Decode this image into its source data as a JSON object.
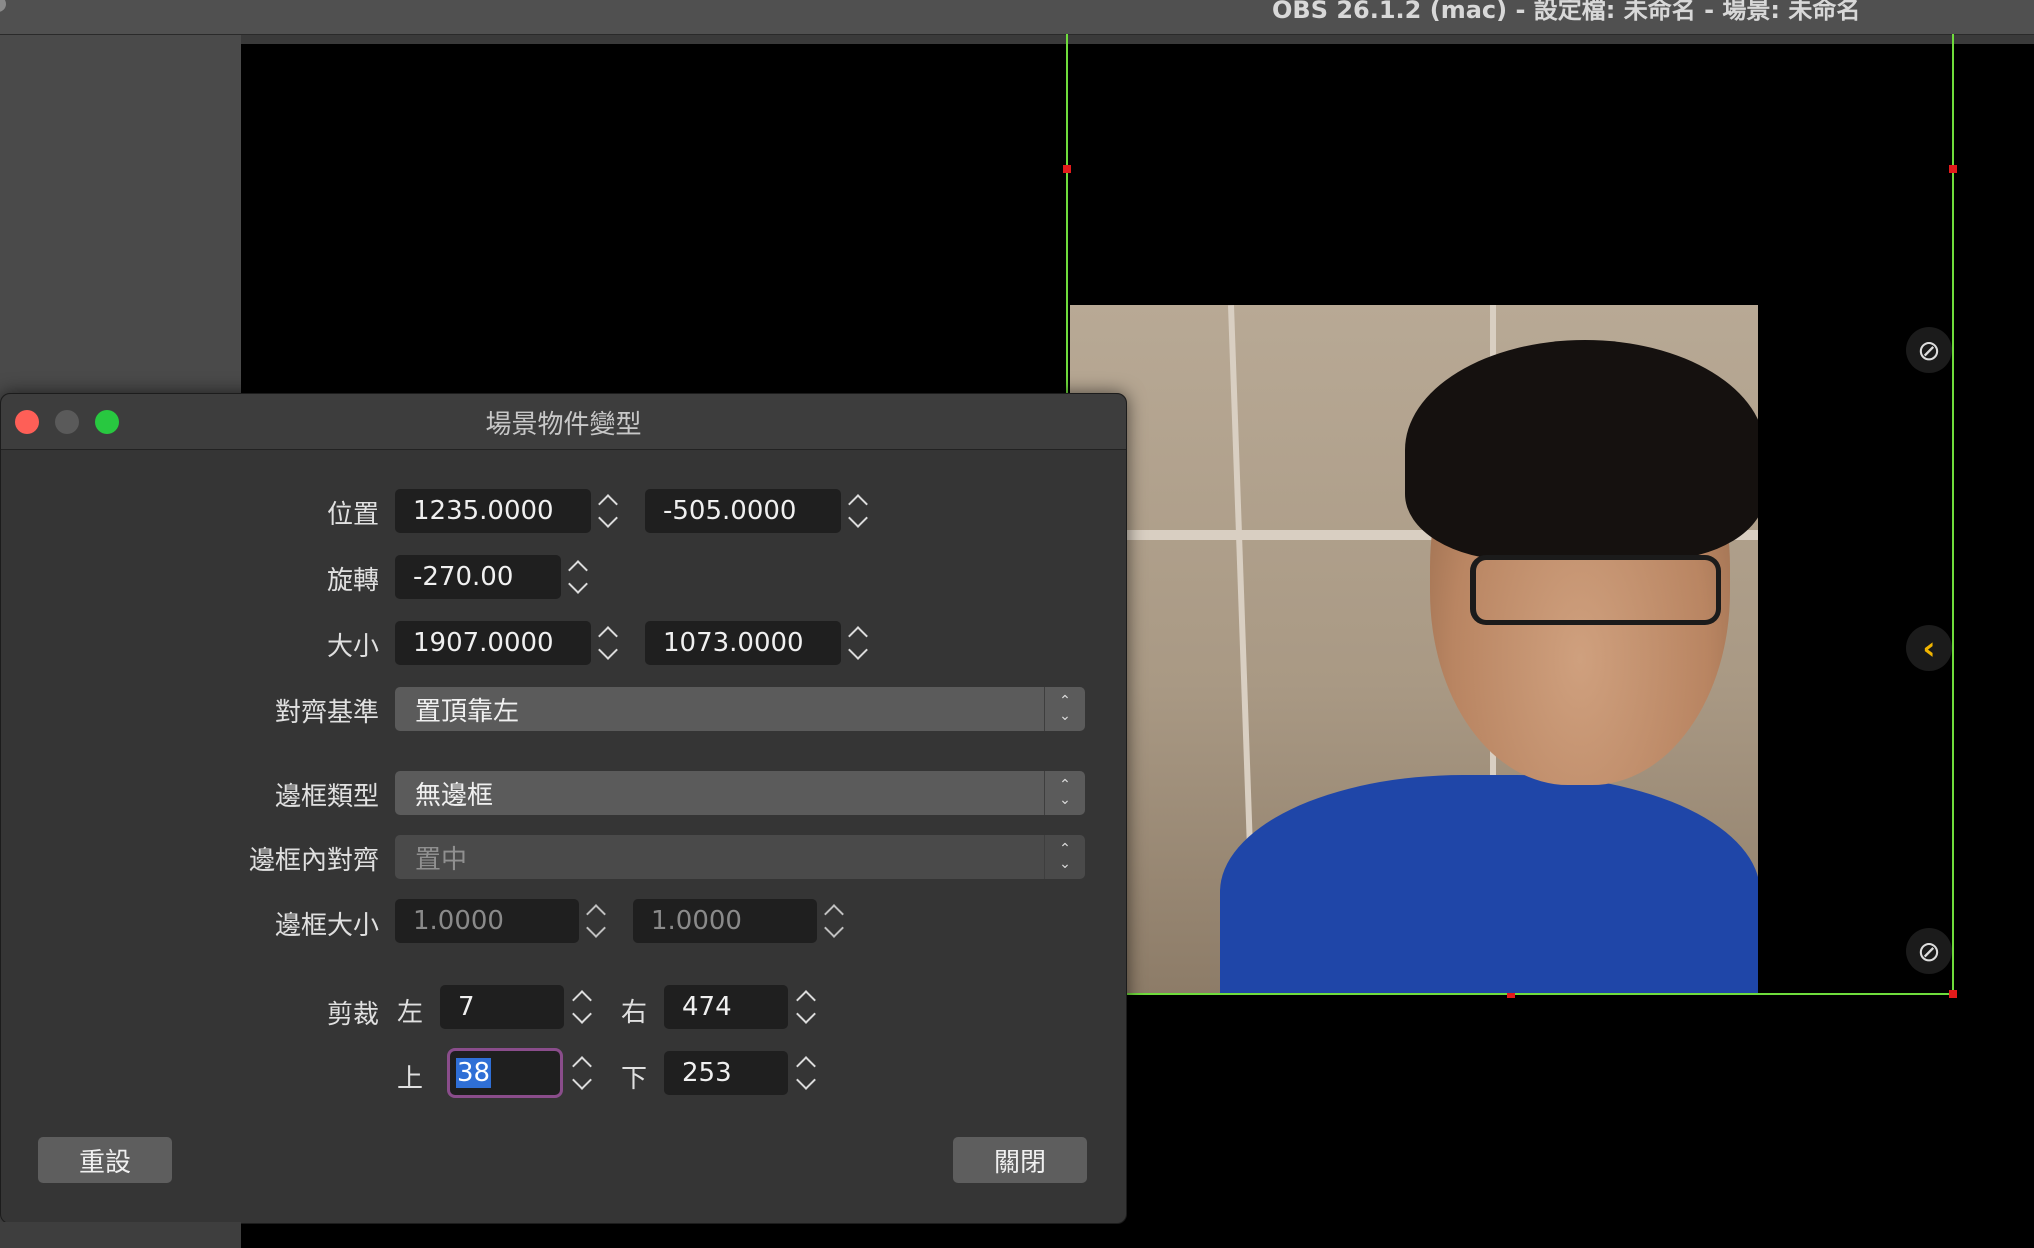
{
  "app_title": "OBS 26.1.2 (mac) - 設定檔: 未命名 - 場景: 未命名",
  "dialog": {
    "title": "場景物件變型",
    "position": {
      "label": "位置",
      "x": "1235.0000",
      "y": "-505.0000"
    },
    "rotation": {
      "label": "旋轉",
      "value": "-270.00"
    },
    "size": {
      "label": "大小",
      "width": "1907.0000",
      "height": "1073.0000"
    },
    "alignment": {
      "label": "對齊基準",
      "value": "置頂靠左"
    },
    "bounds_type": {
      "label": "邊框類型",
      "value": "無邊框"
    },
    "bounds_alignment": {
      "label": "邊框內對齊",
      "value": "置中"
    },
    "bounds_size": {
      "label": "邊框大小",
      "width": "1.0000",
      "height": "1.0000"
    },
    "crop": {
      "label": "剪裁",
      "left_label": "左",
      "left": "7",
      "right_label": "右",
      "right": "474",
      "top_label": "上",
      "top": "38",
      "bottom_label": "下",
      "bottom": "253"
    },
    "reset_label": "重設",
    "close_label": "關閉"
  },
  "icons": {
    "pin_off": "pin-off-icon",
    "arrow": "chevron-left-icon",
    "camera_off": "camera-off-icon"
  },
  "colors": {
    "accent_green": "#6fdc3c",
    "handle_red": "#e31b1b",
    "traffic_close": "#fe5f57",
    "traffic_max": "#28c840",
    "focus_ring": "#8a4d8b",
    "selection": "#2f6fd6"
  }
}
